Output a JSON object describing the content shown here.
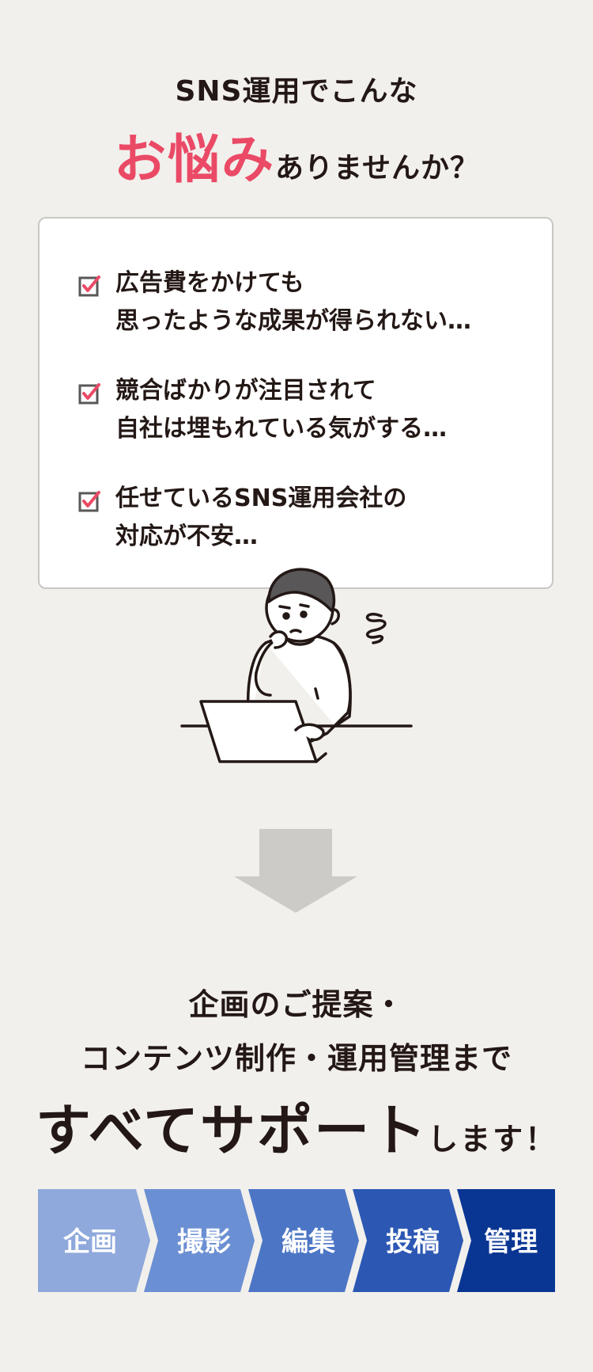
{
  "header": {
    "line1": "SNS運用でこんな",
    "accent": "お悩み",
    "line2_rest": "ありませんか？"
  },
  "worries": [
    {
      "lines": [
        "広告費をかけても",
        "思ったような成果が得られない…"
      ]
    },
    {
      "lines": [
        "競合ばかりが注目されて",
        "自社は埋もれている気がする…"
      ]
    },
    {
      "lines": [
        "任せているSNS運用会社の",
        "対応が不安…"
      ]
    }
  ],
  "solution": {
    "line1": "企画のご提案・",
    "line2": "コンテンツ制作・運用管理まで",
    "emphasis": "すべてサポート",
    "suffix": "します！"
  },
  "steps": [
    "企画",
    "撮影",
    "編集",
    "投稿",
    "管理"
  ],
  "colors": {
    "accent": "#ea4a66",
    "check": "#ea4a66",
    "arrow": "#cccbc7",
    "steps": [
      "#8fa9dc",
      "#6b8fd3",
      "#4c76c5",
      "#2c58b4",
      "#0a3693"
    ]
  },
  "icons": {
    "check": "checkbox-checked-icon",
    "arrow": "down-arrow-icon",
    "illustration": "worried-person-laptop"
  }
}
